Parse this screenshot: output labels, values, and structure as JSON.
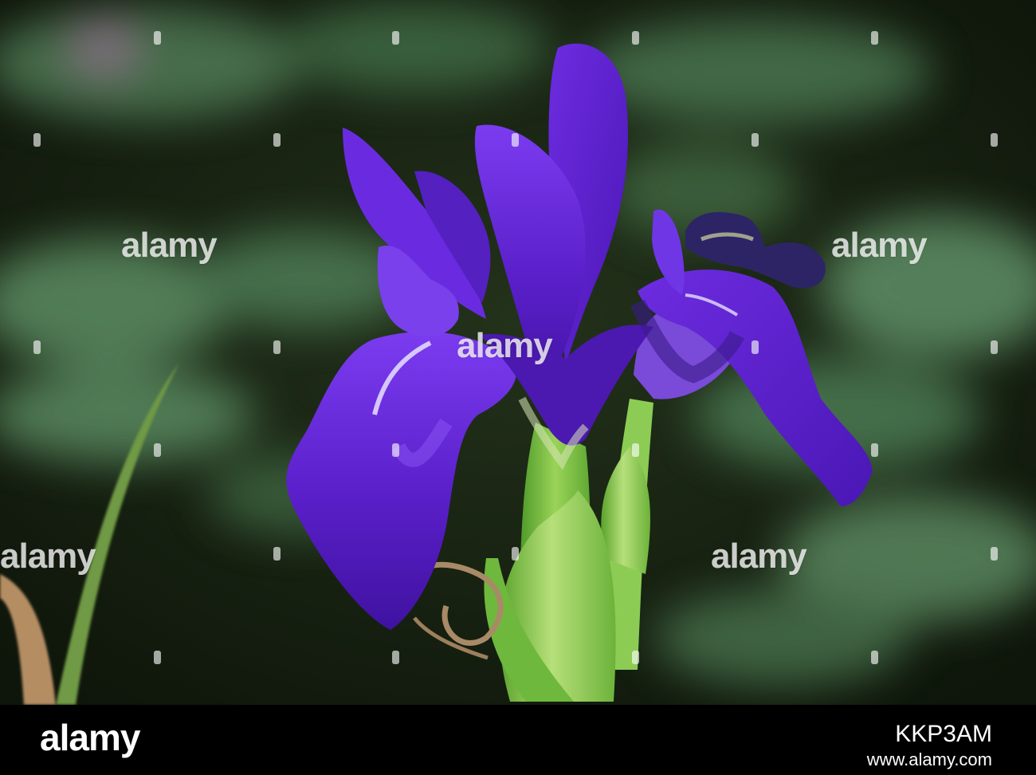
{
  "photo": {
    "subject": "purple-iris-flower",
    "colors": {
      "background": "#17200f",
      "foliage": "#5f8b62",
      "petal": "#5a1fc9",
      "petal_light": "#8a4ff0",
      "stem": "#7fc14a"
    }
  },
  "watermark": {
    "text": "alamy"
  },
  "footer": {
    "logo": "alamy",
    "image_id": "KKP3AM",
    "url": "www.alamy.com"
  }
}
